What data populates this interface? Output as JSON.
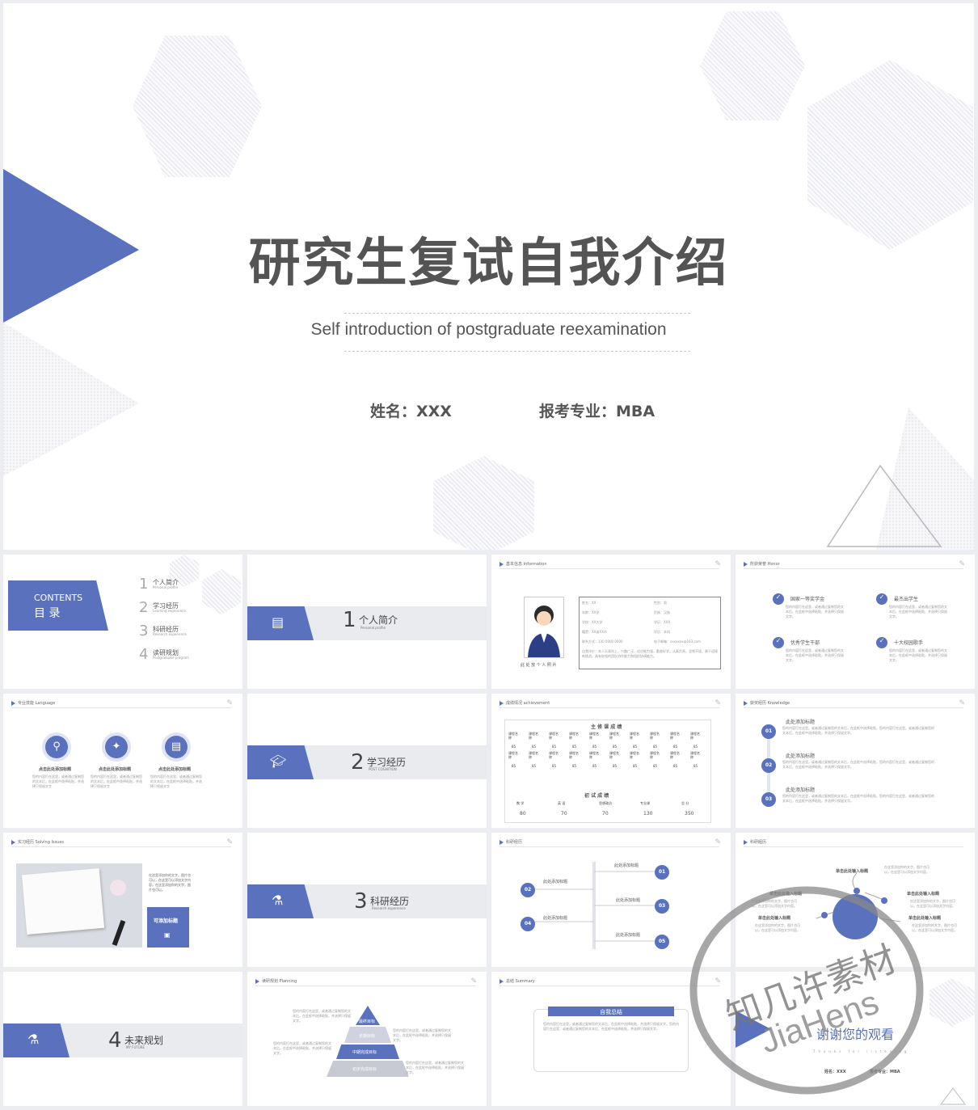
{
  "hero": {
    "title": "研究生复试自我介绍",
    "subtitle": "Self introduction of postgraduate reexamination",
    "name": "姓名：XXX",
    "major": "报考专业：MBA"
  },
  "contents": {
    "en": "CONTENTS",
    "zh": "目  录",
    "items": [
      {
        "n": "1",
        "zh": "个人简介",
        "en": "Personal profile"
      },
      {
        "n": "2",
        "zh": "学习经历",
        "en": "Learning experience"
      },
      {
        "n": "3",
        "zh": "科研经历",
        "en": "Research experience"
      },
      {
        "n": "4",
        "zh": "读研规划",
        "en": "Postgraduate program"
      }
    ]
  },
  "sections": [
    {
      "n": "1",
      "zh": "个人简介",
      "en": "Personal profile",
      "icon": "id-card-icon"
    },
    {
      "n": "2",
      "zh": "学习经历",
      "en": "POST COGNITION",
      "icon": "graduation-cap-icon"
    },
    {
      "n": "3",
      "zh": "科研经历",
      "en": "Research experience",
      "icon": "flask-icon"
    },
    {
      "n": "4",
      "zh": "未来规划",
      "en": "MY FUTURE",
      "icon": "flask-icon"
    }
  ],
  "info": {
    "tag": "基本信息 Information",
    "caption": "此 处 放 个 人 照 片",
    "rows": [
      [
        "姓名：XX",
        "性别：男"
      ],
      [
        "年龄：XX岁",
        "民族：汉族"
      ],
      [
        "学校：XX大学",
        "学历：XXX"
      ],
      [
        "籍贯：XX省XX市",
        "学历：本科"
      ],
      [
        "联系方式：130 0000 0000",
        "电子邮箱：xxxxxxx@163.com"
      ]
    ],
    "eval": "自我评价：本人乐观向上，兴趣广泛，适应能力强，勤奋好学，认真负责，坚韧不拔，勇于迎接新挑战，具有较强的团队协作能力和组织协调能力。"
  },
  "honor": {
    "tag": "所获荣誉 Honor",
    "items": [
      "国家一等奖学金",
      "最杰出学生",
      "优秀学生干部",
      "十大校园歌手"
    ],
    "desc": "您的内容打在这里，或者通过复制您的文本后，在此框中选择粘贴，并选择只保留文字。"
  },
  "lang": {
    "tag": "专业技能 Language",
    "items": [
      "点击此处添加标题",
      "点击此处添加标题",
      "点击此处添加标题"
    ],
    "desc": "您的内容打在这里，或者通过复制您的文本后，在此框中选择粘贴，并选择只保留文字"
  },
  "achv": {
    "tag": "成绩情况 achievement",
    "main_title": "主 修 课 成 绩",
    "course": "课程名称",
    "score": "85",
    "init_title": "初 试 成 绩",
    "init_heads": [
      "数 学",
      "英 语",
      "思想政治",
      "专业课",
      "总 分"
    ],
    "init_vals": [
      "80",
      "70",
      "70",
      "130",
      "350"
    ]
  },
  "know": {
    "tag": "获奖经历 Knowledge",
    "items": [
      {
        "n": "01",
        "t": "此处添加标题"
      },
      {
        "n": "02",
        "t": "此处添加标题"
      },
      {
        "n": "03",
        "t": "此处添加标题"
      }
    ],
    "desc": "您的内容打在这里，或者通过复制您的文本后，在此框中选择粘贴，您的内容打在这里，或者通过复制您的文本后，在此框中选择粘贴，并选择只保留文字。"
  },
  "practice": {
    "tag": "实习经历 Solving Issues",
    "desc": "在这里添加你的文字，图片也可以，在这里可以添加文字内容，在这里添加你的文字，图片也可以。",
    "btn": "可添加标题"
  },
  "research1": {
    "tag": "科研经历",
    "items": [
      {
        "n": "01",
        "t": "此处添加标题"
      },
      {
        "n": "02",
        "t": "此处添加标题"
      },
      {
        "n": "03",
        "t": "此处添加标题"
      },
      {
        "n": "04",
        "t": "此处添加标题"
      },
      {
        "n": "05",
        "t": "此处添加标题"
      }
    ]
  },
  "research2": {
    "tag": "科研经历",
    "items": [
      "单击此处输入标题",
      "单击此处输入标题",
      "单击此处输入标题",
      "单击此处输入标题",
      "单击此处输入标题"
    ],
    "desc": "在这里添加你的文字，图片也可以。在这里可以添加文字内容。"
  },
  "plan": {
    "tag": "读研规划 Planning",
    "levels": [
      "最终目标",
      "长期目标",
      "中期完成目标",
      "初步完成目标"
    ],
    "desc": "您的内容打在这里，或者通过复制您的文本后，在此框中选择粘贴，并选择只保留文字。"
  },
  "summary": {
    "tag": "总结 Summary",
    "title": "自我总结",
    "desc": "您的内容打在这里，或者通过复制您的文本后，在此框中选择粘贴，并选择只保留文字。您的内容打在这里，或者通过复制您的文本后，在此框中选择粘贴，并选择只保留文字。"
  },
  "thanks": {
    "title": "谢谢您的观看",
    "en": "Thanks for listening",
    "name": "姓名：XXX",
    "major": "报考专业：MBA"
  },
  "watermark": {
    "zh": "知几许素材",
    "en": "JiaHens"
  },
  "colors": {
    "accent": "#5a72bd",
    "title": "#545454"
  }
}
